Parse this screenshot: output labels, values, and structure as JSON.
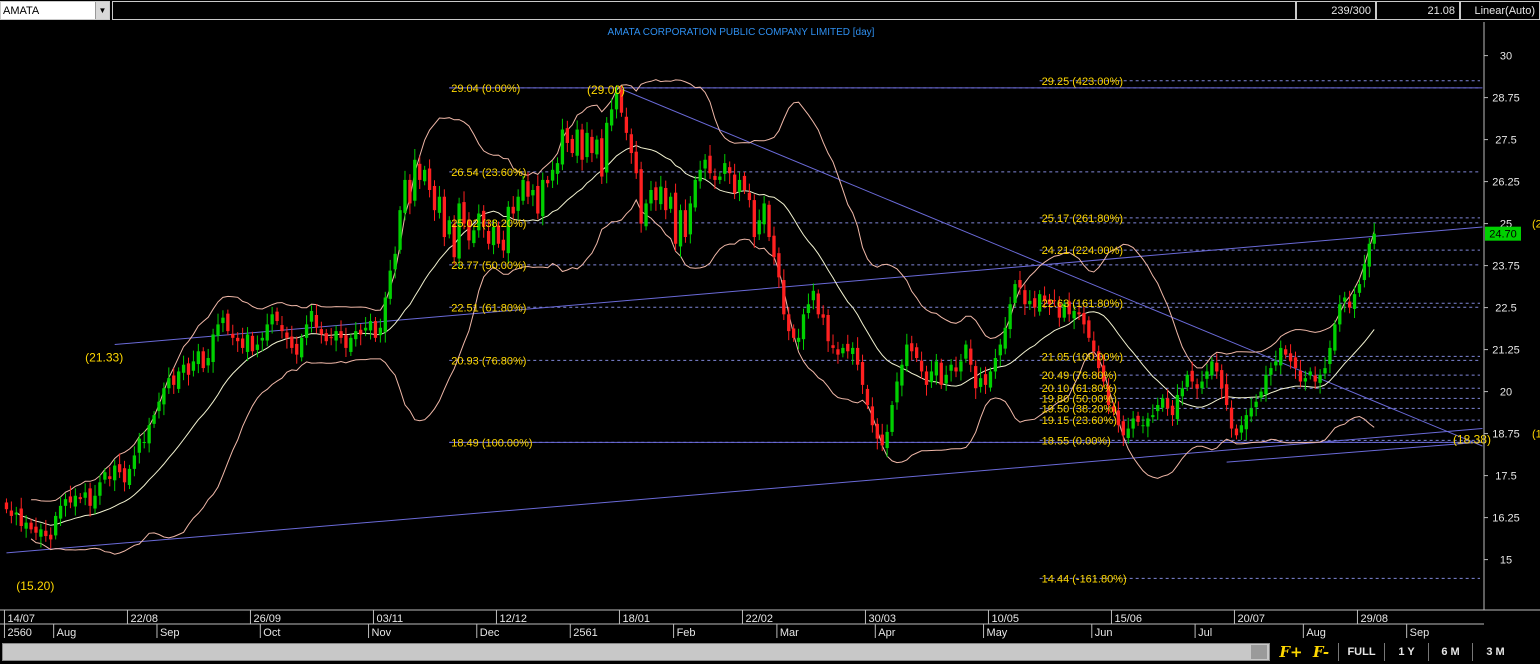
{
  "toolbar": {
    "symbol": "AMATA",
    "bar_count": "239/300",
    "last_price": "21.08",
    "scale_mode": "Linear(Auto)"
  },
  "buttons": {
    "zoom_in": "F+",
    "zoom_out": "F-",
    "full": "FULL",
    "one_year": "1 Y",
    "six_months": "6 M",
    "three_months": "3 M"
  },
  "colors": {
    "up": "#00d000",
    "down": "#ff2020",
    "ma": "#f2f2d0",
    "bollinger": "#f0b8a8",
    "trendline": "#6a6ad8",
    "fib_level": "#7f86d8",
    "fib_text": "#ffd800",
    "title": "#2e8ff0",
    "axis_text": "#e6e6e6"
  },
  "chart_data": {
    "type": "candlestick",
    "title": "AMATA CORPORATION PUBLIC COMPANY LIMITED [day]",
    "ylim": [
      13.5,
      31.0
    ],
    "y_ticks": [
      "30",
      "28.75",
      "27.5",
      "26.25",
      "25",
      "23.75",
      "22.5",
      "21.25",
      "20",
      "18.75",
      "17.5",
      "16.25",
      "15"
    ],
    "last_price_label": "24.70",
    "edge_labels": [
      "(2",
      "(1"
    ],
    "date_ticks": [
      "14/07",
      "22/08",
      "26/09",
      "03/11",
      "12/12",
      "18/01",
      "22/02",
      "30/03",
      "10/05",
      "15/06",
      "20/07",
      "29/08"
    ],
    "month_labels": [
      "2560",
      "Aug",
      "Sep",
      "Oct",
      "Nov",
      "Dec",
      "2561",
      "Feb",
      "Mar",
      "Apr",
      "May",
      "Jun",
      "Jul",
      "Aug",
      "Sep"
    ],
    "close": [
      16.5,
      16.3,
      16.4,
      16.0,
      16.1,
      15.9,
      15.8,
      15.9,
      15.7,
      15.6,
      16.3,
      16.6,
      16.8,
      16.7,
      16.9,
      16.8,
      17.0,
      16.6,
      16.9,
      17.3,
      17.6,
      17.4,
      17.8,
      17.6,
      17.3,
      17.7,
      18.1,
      18.6,
      18.5,
      19.0,
      19.3,
      19.7,
      20.1,
      20.4,
      20.2,
      20.6,
      20.8,
      20.5,
      20.9,
      21.2,
      20.7,
      21.0,
      21.7,
      22.0,
      22.2,
      21.8,
      21.6,
      21.5,
      21.3,
      21.7,
      21.2,
      21.4,
      21.6,
      22.0,
      22.3,
      22.1,
      21.8,
      21.6,
      21.3,
      21.1,
      21.6,
      22.0,
      22.4,
      21.9,
      21.7,
      21.5,
      21.6,
      21.8,
      21.6,
      21.3,
      21.6,
      21.8,
      21.7,
      21.9,
      22.1,
      21.6,
      21.9,
      22.8,
      23.6,
      24.1,
      25.4,
      26.3,
      25.6,
      26.9,
      26.3,
      26.6,
      26.0,
      25.4,
      25.8,
      24.6,
      25.1,
      24.0,
      25.6,
      25.0,
      24.5,
      24.8,
      25.3,
      24.9,
      24.4,
      24.9,
      24.4,
      24.2,
      25.5,
      25.3,
      25.8,
      26.3,
      25.8,
      26.0,
      25.3,
      26.3,
      26.2,
      26.6,
      26.8,
      27.8,
      27.4,
      27.1,
      27.8,
      26.9,
      27.7,
      27.1,
      27.5,
      26.4,
      28.0,
      28.4,
      28.9,
      28.3,
      27.7,
      27.1,
      26.5,
      25.0,
      25.6,
      26.0,
      25.7,
      26.1,
      25.4,
      25.8,
      24.4,
      25.4,
      24.6,
      25.6,
      26.3,
      26.6,
      26.9,
      26.5,
      26.3,
      26.4,
      26.8,
      26.5,
      25.9,
      26.3,
      26.0,
      25.7,
      24.6,
      25.1,
      25.6,
      24.6,
      24.0,
      23.4,
      22.3,
      21.8,
      21.6,
      21.6,
      22.3,
      22.6,
      23.0,
      22.3,
      22.2,
      21.5,
      21.3,
      21.1,
      21.3,
      21.2,
      21.3,
      20.8,
      20.2,
      19.6,
      19.0,
      18.6,
      18.4,
      18.8,
      19.6,
      20.3,
      20.8,
      21.4,
      21.2,
      21.0,
      20.6,
      20.2,
      20.6,
      20.9,
      20.2,
      20.5,
      20.8,
      20.6,
      20.9,
      21.4,
      20.8,
      20.1,
      20.4,
      20.2,
      20.6,
      21.0,
      21.4,
      21.9,
      22.6,
      23.2,
      23.1,
      22.6,
      22.7,
      22.5,
      22.9,
      22.7,
      22.6,
      22.7,
      22.2,
      22.6,
      22.3,
      22.4,
      22.3,
      22.0,
      21.6,
      21.2,
      20.7,
      20.3,
      19.6,
      19.4,
      19.0,
      18.7,
      18.9,
      19.2,
      19.1,
      19.0,
      19.2,
      19.3,
      19.6,
      19.8,
      19.5,
      19.3,
      19.9,
      20.1,
      20.5,
      20.3,
      20.1,
      20.3,
      20.6,
      20.9,
      20.6,
      20.1,
      19.6,
      18.9,
      18.7,
      19.0,
      19.3,
      19.5,
      19.7,
      20.0,
      20.5,
      20.7,
      20.9,
      21.3,
      21.1,
      20.9,
      20.7,
      20.3,
      20.4,
      20.6,
      20.3,
      20.5,
      20.7,
      21.3,
      22.0,
      22.6,
      22.8,
      22.5,
      22.9,
      23.2,
      23.8,
      24.4,
      24.7
    ],
    "trendlines": [
      {
        "from": [
          0.0,
          15.2
        ],
        "to": [
          300.0,
          18.9
        ]
      },
      {
        "from": [
          22.0,
          21.4
        ],
        "to": [
          300.0,
          24.9
        ]
      },
      {
        "from": [
          125.0,
          29.0
        ],
        "to": [
          300.0,
          18.38
        ]
      },
      {
        "from": [
          90.0,
          29.04
        ],
        "to": [
          300.0,
          29.04
        ]
      },
      {
        "from": [
          90.0,
          18.49
        ],
        "to": [
          300.0,
          18.49
        ]
      },
      {
        "from": [
          248.0,
          17.9
        ],
        "to": [
          300.0,
          18.5
        ]
      }
    ],
    "fib_sets": [
      {
        "levels": [
          {
            "value": 29.04,
            "label": "29.04 (0.00%)"
          },
          {
            "value": 26.54,
            "label": "26.54 (23.60%)"
          },
          {
            "value": 25.02,
            "label": "25.02 (38.20%)"
          },
          {
            "value": 23.77,
            "label": "23.77 (50.00%)"
          },
          {
            "value": 22.51,
            "label": "22.51 (61.80%)"
          },
          {
            "value": 20.93,
            "label": "20.93 (76.80%)"
          },
          {
            "value": 18.49,
            "label": "18.49 (100.00%)"
          }
        ]
      },
      {
        "levels": [
          {
            "value": 29.25,
            "label": "29.25 (423.00%)"
          },
          {
            "value": 25.17,
            "label": "25.17 (261.80%)"
          },
          {
            "value": 24.21,
            "label": "24.21 (224.00%)"
          },
          {
            "value": 22.63,
            "label": "22.63 (161.80%)"
          },
          {
            "value": 21.05,
            "label": "21.05 (100.00%)"
          },
          {
            "value": 20.49,
            "label": "20.49 (76.80%)"
          },
          {
            "value": 20.1,
            "label": "20.10 (61.80%)"
          },
          {
            "value": 19.8,
            "label": "19.80 (50.00%)"
          },
          {
            "value": 19.5,
            "label": "19.50 (38.20%)"
          },
          {
            "value": 19.15,
            "label": "19.15 (23.60%)"
          },
          {
            "value": 18.55,
            "label": "18.55 (0.00%)"
          },
          {
            "value": 14.44,
            "label": "14.44 (-161.80%)"
          }
        ]
      }
    ],
    "annotations": [
      {
        "text": "(29.00)",
        "x": 118.0,
        "y": 28.85
      },
      {
        "text": "(21.33)",
        "x": 16.0,
        "y": 20.9
      },
      {
        "text": "(15.20)",
        "x": 2.0,
        "y": 14.1
      },
      {
        "text": "(18.38)",
        "x": 294.0,
        "y": 18.45
      }
    ]
  }
}
